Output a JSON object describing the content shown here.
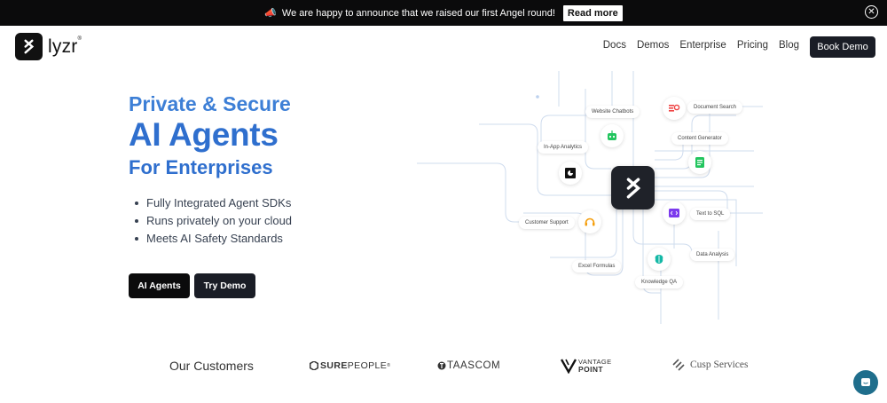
{
  "announcement": {
    "emoji": "📣",
    "text": "We are happy to announce that we raised our first Angel round!",
    "button": "Read more"
  },
  "header": {
    "logo_text": "lyzr",
    "logo_mark": "®",
    "nav": [
      "Docs",
      "Demos",
      "Enterprise",
      "Pricing",
      "Blog"
    ],
    "book_demo": "Book Demo"
  },
  "hero": {
    "line1": "Private & Secure",
    "line2": "AI Agents",
    "line3": "For Enterprises",
    "features": [
      "Fully Integrated Agent SDKs",
      "Runs privately on your cloud",
      "Meets AI Safety Standards"
    ],
    "cta_primary": "AI Agents",
    "cta_secondary": "Try Demo"
  },
  "diagram": {
    "labels": {
      "website_chatbots": "Website Chatbots",
      "document_search": "Document Search",
      "in_app_analytics": "In-App Analytics",
      "content_generator": "Content Generator",
      "customer_support": "Customer Support",
      "text_to_sql": "Text to SQL",
      "data_analysis": "Data Analysis",
      "excel_formulas": "Excel Formulas",
      "knowledge_qa": "Knowledge QA"
    },
    "colors": {
      "line": "#cfdcee",
      "accent_red": "#ef4444",
      "accent_green": "#22c55e",
      "accent_orange": "#f59e0b",
      "accent_purple": "#7c3aed",
      "accent_teal": "#14b8a6"
    }
  },
  "customers": {
    "title": "Our Customers",
    "logos": [
      {
        "name": "SUREPEOPLE",
        "bold": "SURE",
        "rest": "PEOPLE",
        "mark": "®"
      },
      {
        "name": "TAASCOM",
        "text": "TAASCOM"
      },
      {
        "name": "VANTAGE POINT",
        "line1": "VANTAGE",
        "line2": "POINT"
      },
      {
        "name": "Cusp Services",
        "text": "Cusp Services"
      }
    ]
  }
}
